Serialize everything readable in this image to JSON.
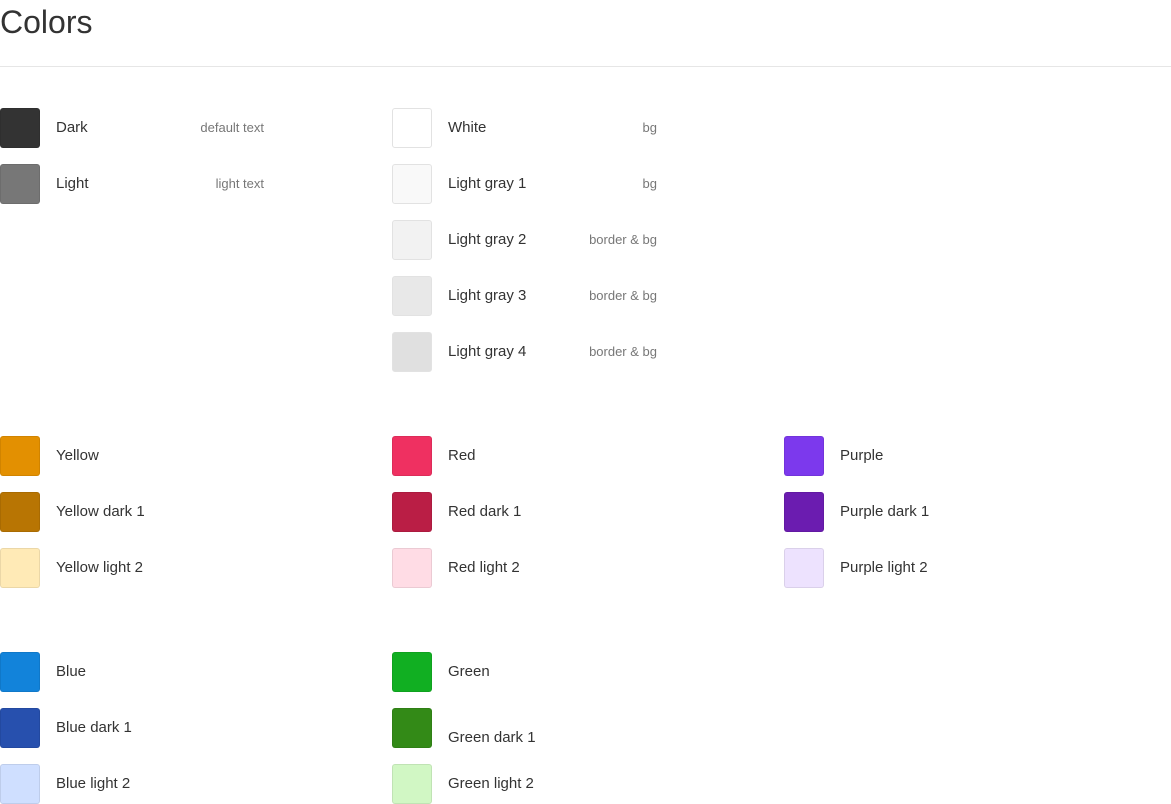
{
  "page": {
    "title": "Colors"
  },
  "neutrals_dark": [
    {
      "name": "Dark",
      "usage": "default text",
      "color": "#333333"
    },
    {
      "name": "Light",
      "usage": "light text",
      "color": "#777777"
    }
  ],
  "neutrals_light": [
    {
      "name": "White",
      "usage": "bg",
      "color": "#ffffff"
    },
    {
      "name": "Light gray 1",
      "usage": "bg",
      "color": "#f9f9f9"
    },
    {
      "name": "Light gray 2",
      "usage": "border & bg",
      "color": "#f2f2f2"
    },
    {
      "name": "Light gray 3",
      "usage": "border & bg",
      "color": "#e8e8e8"
    },
    {
      "name": "Light gray 4",
      "usage": "border & bg",
      "color": "#e0e0e0"
    }
  ],
  "yellow": [
    {
      "name": "Yellow",
      "color": "#e39001"
    },
    {
      "name": "Yellow dark 1",
      "color": "#b87503"
    },
    {
      "name": "Yellow light 2",
      "color": "#ffeab6"
    }
  ],
  "red": [
    {
      "name": "Red",
      "color": "#ef3061"
    },
    {
      "name": "Red dark 1",
      "color": "#ba1e45"
    },
    {
      "name": "Red light 2",
      "color": "#ffdce5"
    }
  ],
  "purple": [
    {
      "name": "Purple",
      "color": "#7c39ed"
    },
    {
      "name": "Purple dark 1",
      "color": "#6b1cb0"
    },
    {
      "name": "Purple light 2",
      "color": "#ede2fe"
    }
  ],
  "blue": [
    {
      "name": "Blue",
      "color": "#1283da"
    },
    {
      "name": "Blue dark 1",
      "color": "#2750ae"
    },
    {
      "name": "Blue light 2",
      "color": "#cfdfff"
    }
  ],
  "green": [
    {
      "name": "Green",
      "color": "#11af22"
    },
    {
      "name": "Green dark 1",
      "color": "#338a17"
    },
    {
      "name": "Green light 2",
      "color": "#d1f7c4"
    }
  ]
}
